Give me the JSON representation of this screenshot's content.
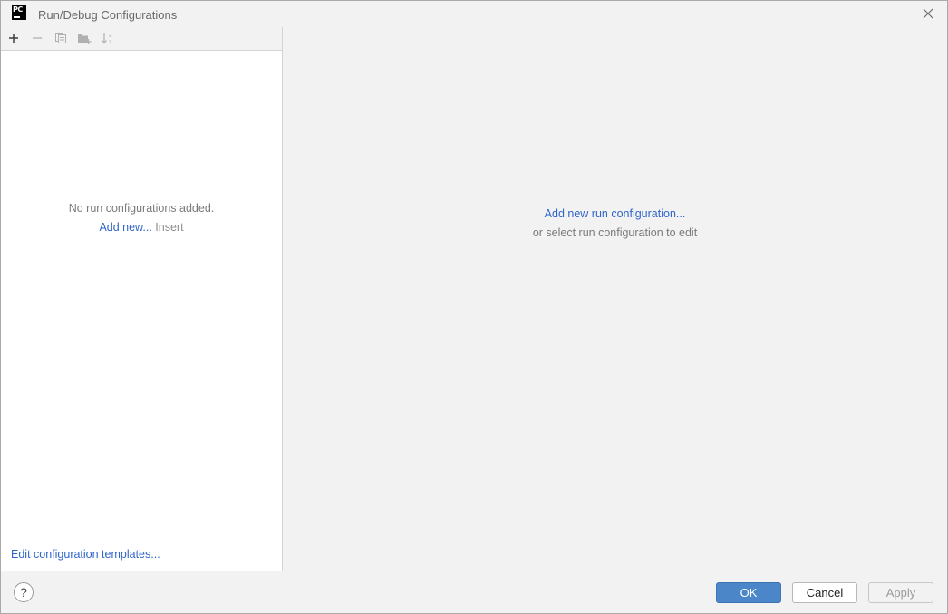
{
  "window": {
    "title": "Run/Debug Configurations",
    "app_icon_text": "PC"
  },
  "toolbar": {
    "add_tooltip": "Add New Configuration",
    "remove_tooltip": "Remove Configuration",
    "copy_tooltip": "Copy Configuration",
    "folder_tooltip": "Move into new folder",
    "sort_tooltip": "Sort configurations"
  },
  "left_pane": {
    "empty_message": "No run configurations added.",
    "add_new_link": "Add new...",
    "add_new_shortcut": "Insert",
    "templates_link": "Edit configuration templates..."
  },
  "right_pane": {
    "add_link": "Add new run configuration...",
    "hint": "or select run configuration to edit"
  },
  "footer": {
    "help_label": "?",
    "ok_label": "OK",
    "cancel_label": "Cancel",
    "apply_label": "Apply"
  },
  "colors": {
    "link": "#2f65ca",
    "ok_button": "#4a86c8",
    "background": "#f2f2f2",
    "list_background": "#ffffff"
  }
}
